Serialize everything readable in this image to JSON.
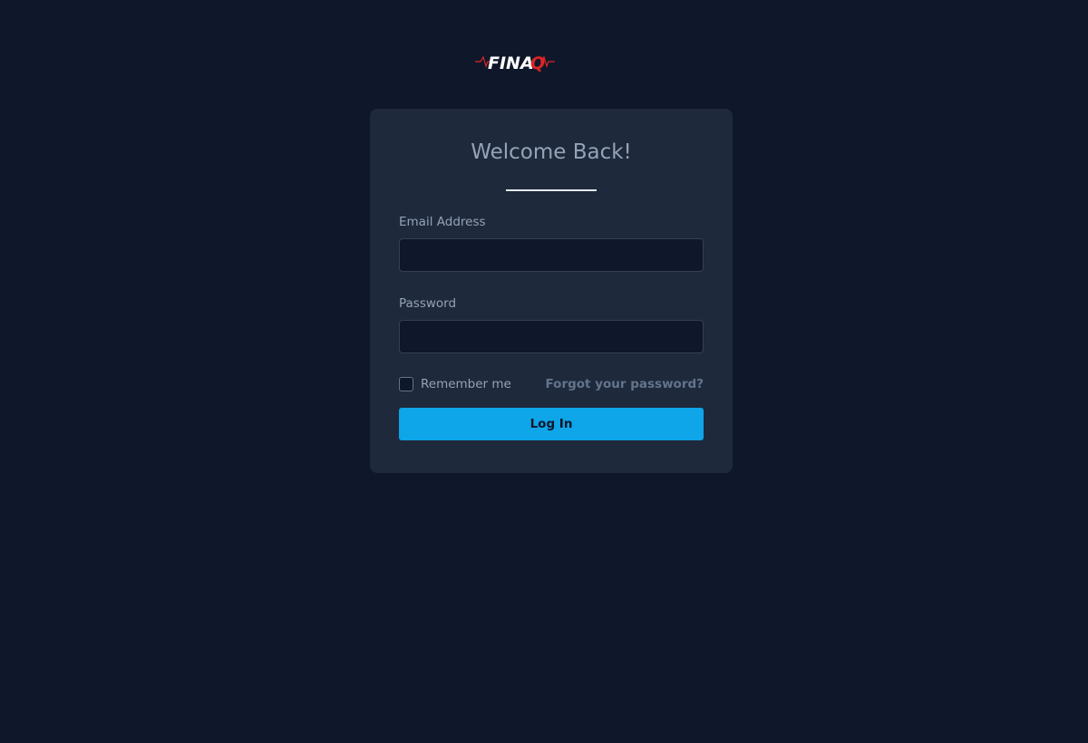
{
  "brand": {
    "logo_text": "FINAQ",
    "logo_icon": "heartbeat-wordmark-logo",
    "colors": {
      "text_white": "#ffffff",
      "text_red": "#dc2626",
      "pulse_red": "#dc2626"
    }
  },
  "login_card": {
    "title": "Welcome Back!",
    "email": {
      "label": "Email Address",
      "value": "",
      "placeholder": ""
    },
    "password": {
      "label": "Password",
      "value": "",
      "placeholder": ""
    },
    "remember_me": {
      "label": "Remember me",
      "checked": false
    },
    "forgot_password_link": "Forgot your password?",
    "submit_button": "Log In"
  },
  "colors": {
    "page_background": "#0f172a",
    "card_background": "#1e293b",
    "accent": "#0ea5e9",
    "muted_text": "#94a3b8"
  }
}
